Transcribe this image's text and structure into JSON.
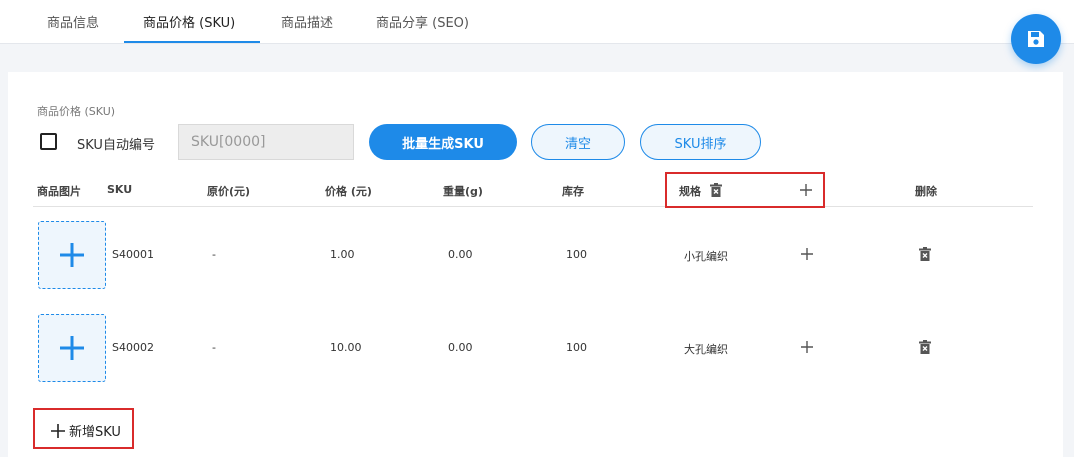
{
  "tabs": [
    {
      "label": "商品信息"
    },
    {
      "label": "商品价格 (SKU)"
    },
    {
      "label": "商品描述"
    },
    {
      "label": "商品分享 (SEO)"
    }
  ],
  "active_tab": 1,
  "section": {
    "title": "商品价格 (SKU)"
  },
  "toolbar": {
    "auto_number_label": "SKU自动编号",
    "auto_number_checked": false,
    "sku_pattern_placeholder": "SKU[0000]",
    "generate_label": "批量生成SKU",
    "clear_label": "清空",
    "sort_label": "SKU排序"
  },
  "table": {
    "headers": {
      "image": "商品图片",
      "sku": "SKU",
      "original_price": "原价(元)",
      "price": "价格 (元)",
      "weight": "重量(g)",
      "stock": "库存",
      "spec": "规格",
      "delete": "删除"
    },
    "rows": [
      {
        "sku": "S40001",
        "original_price": "-",
        "price": "1.00",
        "weight": "0.00",
        "stock": "100",
        "spec": "小孔编织"
      },
      {
        "sku": "S40002",
        "original_price": "-",
        "price": "10.00",
        "weight": "0.00",
        "stock": "100",
        "spec": "大孔编织"
      }
    ]
  },
  "add_sku": {
    "label": "新增SKU"
  },
  "colors": {
    "accent": "#1e8ae8",
    "highlight_box": "#d92b2b"
  },
  "icons": {
    "save": "floppy-disk-icon",
    "delete": "trash-icon",
    "add": "plus-icon",
    "image_upload": "plus-icon"
  }
}
